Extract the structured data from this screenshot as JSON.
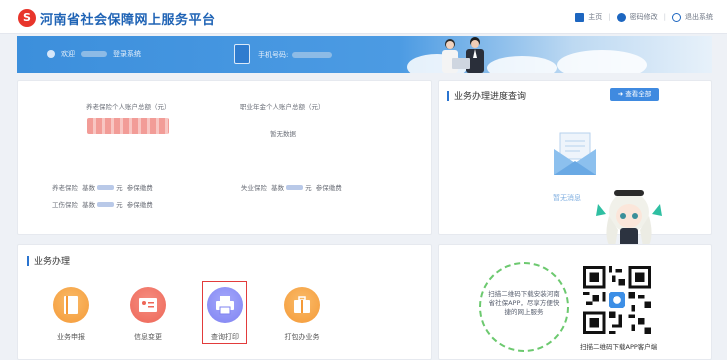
{
  "header": {
    "brand": "河南省社会保障网上服务平台",
    "links": [
      {
        "label": "主页",
        "icon": "home-icon"
      },
      {
        "label": "密码修改",
        "icon": "gear-icon"
      },
      {
        "label": "退出系统",
        "icon": "power-icon"
      }
    ]
  },
  "banner": {
    "welcome_prefix": "欢迎",
    "welcome_suffix": "登录系统",
    "phone_label": "手机号码:"
  },
  "account": {
    "pension_label": "养老保险个人账户总额（元）",
    "annuity_label": "职业年金个人账户总额（元）",
    "annuity_value": "暂无数据",
    "pension_row": {
      "name": "养老保险",
      "base": "基数",
      "unit": "元",
      "status": "参保缴费"
    },
    "injury_row": {
      "name": "工伤保险",
      "base": "基数",
      "unit": "元",
      "status": "参保缴费"
    },
    "unemp_row": {
      "name": "失业保险",
      "base": "基数",
      "unit": "元",
      "status": "参保缴费"
    }
  },
  "progress": {
    "title": "业务办理进度查询",
    "view_all": "查看全部",
    "empty": "暂无消息"
  },
  "business": {
    "title": "业务办理",
    "items": [
      {
        "label": "业务申报",
        "icon": "book-icon",
        "color": "#f7a44a"
      },
      {
        "label": "信息变更",
        "icon": "id-card-icon",
        "color": "#f07667"
      },
      {
        "label": "查询打印",
        "icon": "printer-icon",
        "color": "#8b8ff5"
      },
      {
        "label": "打包办业务",
        "icon": "briefcase-icon",
        "color": "#f7a44a"
      }
    ]
  },
  "qr": {
    "tip": "扫描二维码下载安装河南省社保APP，尽享方便快捷的网上服务",
    "caption": "扫描二维码下载APP客户端"
  },
  "colors": {
    "brand_blue": "#1f63b5",
    "accent": "#3f8ae0",
    "select_red": "#e23b3b"
  }
}
